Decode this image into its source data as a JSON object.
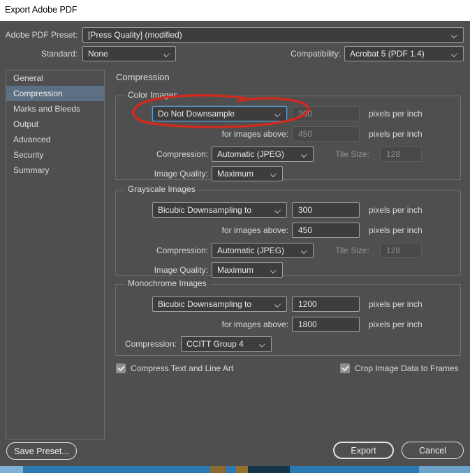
{
  "window": {
    "title": "Export Adobe PDF"
  },
  "header": {
    "preset": {
      "label": "Adobe PDF Preset:",
      "value": "[Press Quality] (modified)"
    },
    "standard": {
      "label": "Standard:",
      "value": "None"
    },
    "compatibility": {
      "label": "Compatibility:",
      "value": "Acrobat 5 (PDF 1.4)"
    }
  },
  "sidebar": {
    "items": [
      {
        "label": "General",
        "selected": false
      },
      {
        "label": "Compression",
        "selected": true
      },
      {
        "label": "Marks and Bleeds",
        "selected": false
      },
      {
        "label": "Output",
        "selected": false
      },
      {
        "label": "Advanced",
        "selected": false
      },
      {
        "label": "Security",
        "selected": false
      },
      {
        "label": "Summary",
        "selected": false
      }
    ]
  },
  "panel": {
    "title": "Compression",
    "color_images": {
      "legend": "Color Images",
      "sampling_value": "Do Not Downsample",
      "resolution_value": "300",
      "resolution_unit": "pixels per inch",
      "threshold_label": "for images above:",
      "threshold_value": "450",
      "threshold_unit": "pixels per inch",
      "compression_label": "Compression:",
      "compression_value": "Automatic (JPEG)",
      "tile_size_label": "Tile Size:",
      "tile_size_value": "128",
      "quality_label": "Image Quality:",
      "quality_value": "Maximum"
    },
    "grayscale_images": {
      "legend": "Grayscale Images",
      "sampling_value": "Bicubic Downsampling to",
      "resolution_value": "300",
      "resolution_unit": "pixels per inch",
      "threshold_label": "for images above:",
      "threshold_value": "450",
      "threshold_unit": "pixels per inch",
      "compression_label": "Compression:",
      "compression_value": "Automatic (JPEG)",
      "tile_size_label": "Tile Size:",
      "tile_size_value": "128",
      "quality_label": "Image Quality:",
      "quality_value": "Maximum"
    },
    "monochrome_images": {
      "legend": "Monochrome Images",
      "sampling_value": "Bicubic Downsampling to",
      "resolution_value": "1200",
      "resolution_unit": "pixels per inch",
      "threshold_label": "for images above:",
      "threshold_value": "1800",
      "threshold_unit": "pixels per inch",
      "compression_label": "Compression:",
      "compression_value": "CCITT Group 4"
    },
    "options": [
      {
        "label": "Compress Text and Line Art",
        "checked": true
      },
      {
        "label": "Crop Image Data to Frames",
        "checked": true
      }
    ]
  },
  "footer": {
    "save_preset_label": "Save Preset...",
    "export_label": "Export",
    "cancel_label": "Cancel"
  },
  "annotation": {
    "shape": "hand-drawn red ellipse",
    "target": "color-images-sampling-dropdown",
    "color": "#d6281a"
  },
  "colors": {
    "dialog_bg": "#4f4f4f",
    "control_bg": "#3d3d3d",
    "selected_item_bg": "#5d6f82",
    "focus_border": "#5aa2de",
    "titlebar_bg": "#ffffff",
    "taskbar_strip": "#2a79b3"
  }
}
